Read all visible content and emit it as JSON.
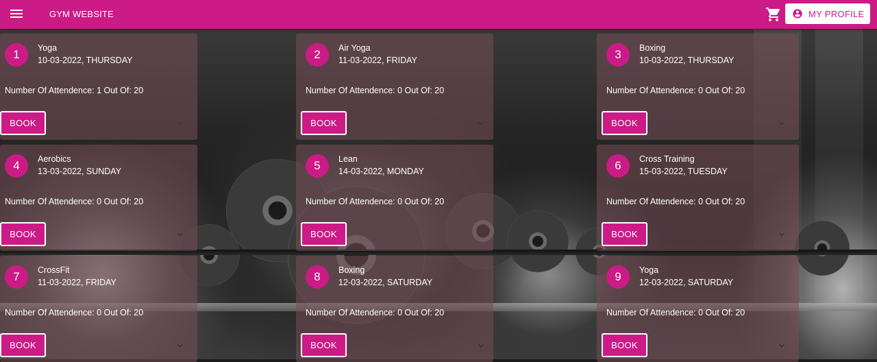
{
  "appbar": {
    "title": "GYM WEBSITE",
    "profile_label": "MY PROFILE",
    "menu_icon": "menu-icon",
    "cart_icon": "cart-icon",
    "account_icon": "account-circle-icon",
    "color": "#cc1a86"
  },
  "classes": [
    {
      "num": "1",
      "name": "Yoga",
      "date": "10-03-2022, THURSDAY",
      "attendance": "Number Of Attendence: 1 Out Of: 20",
      "book": "BOOK"
    },
    {
      "num": "2",
      "name": "Air Yoga",
      "date": "11-03-2022, FRIDAY",
      "attendance": "Number Of Attendence: 0 Out Of: 20",
      "book": "BOOK"
    },
    {
      "num": "3",
      "name": "Boxing",
      "date": "10-03-2022, THURSDAY",
      "attendance": "Number Of Attendence: 0 Out Of: 20",
      "book": "BOOK"
    },
    {
      "num": "4",
      "name": "Aerobics",
      "date": "13-03-2022, SUNDAY",
      "attendance": "Number Of Attendence: 0 Out Of: 20",
      "book": "BOOK"
    },
    {
      "num": "5",
      "name": "Lean",
      "date": "14-03-2022, MONDAY",
      "attendance": "Number Of Attendence: 0 Out Of: 20",
      "book": "BOOK"
    },
    {
      "num": "6",
      "name": "Cross Training",
      "date": "15-03-2022, TUESDAY",
      "attendance": "Number Of Attendence: 0 Out Of: 20",
      "book": "BOOK"
    },
    {
      "num": "7",
      "name": "CrossFit",
      "date": "11-03-2022, FRIDAY",
      "attendance": "Number Of Attendence: 0 Out Of: 20",
      "book": "BOOK"
    },
    {
      "num": "8",
      "name": "Boxing",
      "date": "12-03-2022, SATURDAY",
      "attendance": "Number Of Attendence: 0 Out Of: 20",
      "book": "BOOK"
    },
    {
      "num": "9",
      "name": "Yoga",
      "date": "12-03-2022, SATURDAY",
      "attendance": "Number Of Attendence: 0 Out Of: 20",
      "book": "BOOK"
    }
  ]
}
